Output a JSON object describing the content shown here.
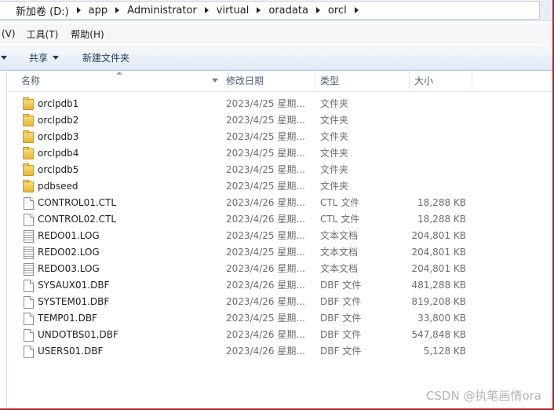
{
  "address": {
    "segments": [
      "新加卷 (D:)",
      "app",
      "Administrator",
      "virtual",
      "oradata",
      "orcl"
    ]
  },
  "menu": {
    "items": [
      "(V)",
      "工具(T)",
      "帮助(H)"
    ]
  },
  "toolbar": {
    "share_label": "共享",
    "new_folder_label": "新建文件夹"
  },
  "columns": {
    "name": "名称",
    "date": "修改日期",
    "type": "类型",
    "size": "大小"
  },
  "files": [
    {
      "name": "orclpdb1",
      "date": "2023/4/25 星期...",
      "type": "文件夹",
      "size": "",
      "icon": "folder-icon"
    },
    {
      "name": "orclpdb2",
      "date": "2023/4/25 星期...",
      "type": "文件夹",
      "size": "",
      "icon": "folder-icon"
    },
    {
      "name": "orclpdb3",
      "date": "2023/4/25 星期...",
      "type": "文件夹",
      "size": "",
      "icon": "folder-icon"
    },
    {
      "name": "orclpdb4",
      "date": "2023/4/25 星期...",
      "type": "文件夹",
      "size": "",
      "icon": "folder-icon"
    },
    {
      "name": "orclpdb5",
      "date": "2023/4/25 星期...",
      "type": "文件夹",
      "size": "",
      "icon": "folder-icon"
    },
    {
      "name": "pdbseed",
      "date": "2023/4/25 星期...",
      "type": "文件夹",
      "size": "",
      "icon": "folder-icon"
    },
    {
      "name": "CONTROL01.CTL",
      "date": "2023/4/26 星期...",
      "type": "CTL 文件",
      "size": "18,288 KB",
      "icon": "file-icon"
    },
    {
      "name": "CONTROL02.CTL",
      "date": "2023/4/26 星期...",
      "type": "CTL 文件",
      "size": "18,288 KB",
      "icon": "file-icon"
    },
    {
      "name": "REDO01.LOG",
      "date": "2023/4/25 星期...",
      "type": "文本文档",
      "size": "204,801 KB",
      "icon": "text-file-icon"
    },
    {
      "name": "REDO02.LOG",
      "date": "2023/4/25 星期...",
      "type": "文本文档",
      "size": "204,801 KB",
      "icon": "text-file-icon"
    },
    {
      "name": "REDO03.LOG",
      "date": "2023/4/26 星期...",
      "type": "文本文档",
      "size": "204,801 KB",
      "icon": "text-file-icon"
    },
    {
      "name": "SYSAUX01.DBF",
      "date": "2023/4/26 星期...",
      "type": "DBF 文件",
      "size": "481,288 KB",
      "icon": "file-icon"
    },
    {
      "name": "SYSTEM01.DBF",
      "date": "2023/4/26 星期...",
      "type": "DBF 文件",
      "size": "819,208 KB",
      "icon": "file-icon"
    },
    {
      "name": "TEMP01.DBF",
      "date": "2023/4/25 星期...",
      "type": "DBF 文件",
      "size": "33,800 KB",
      "icon": "file-icon"
    },
    {
      "name": "UNDOTBS01.DBF",
      "date": "2023/4/26 星期...",
      "type": "DBF 文件",
      "size": "547,848 KB",
      "icon": "file-icon"
    },
    {
      "name": "USERS01.DBF",
      "date": "2023/4/26 星期...",
      "type": "DBF 文件",
      "size": "5,128 KB",
      "icon": "file-icon"
    }
  ],
  "watermark": "CSDN @执笔画情ora"
}
